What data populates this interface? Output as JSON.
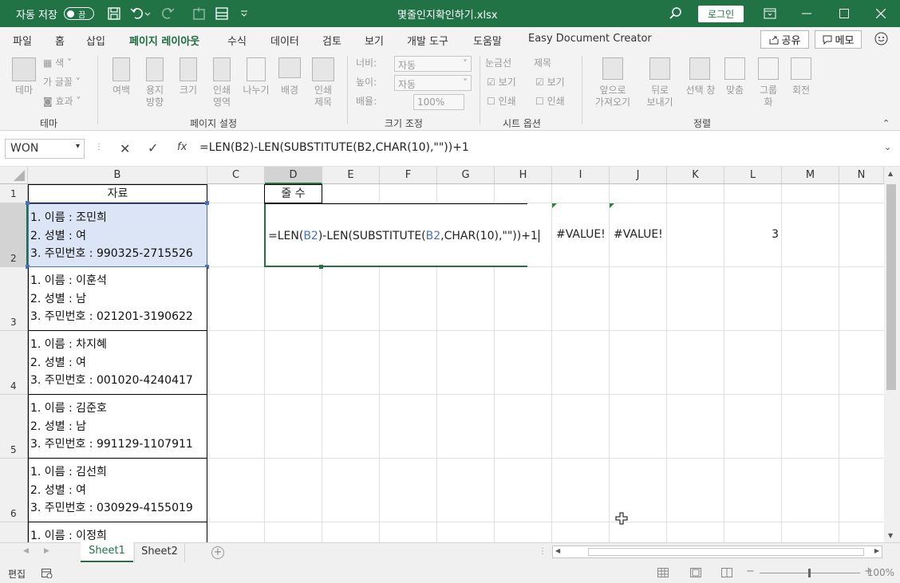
{
  "titlebar": {
    "autosave_label": "자동 저장",
    "autosave_state": "끔",
    "filename": "몇줄인지확인하기.xlsx",
    "login": "로그인"
  },
  "ribbon_tabs": [
    "파일",
    "홈",
    "삽입",
    "페이지 레이아웃",
    "수식",
    "데이터",
    "검토",
    "보기",
    "개발 도구",
    "도움말",
    "Easy Document Creator"
  ],
  "active_tab": "페이지 레이아웃",
  "share": "공유",
  "memo": "메모",
  "groups": {
    "theme": {
      "label": "테마",
      "theme_btn": "테마",
      "colors": "색",
      "fonts": "글꼴",
      "effects": "효과"
    },
    "page_setup": {
      "label": "페이지 설정",
      "margins": "여백",
      "orientation": "용지\n방향",
      "size": "크기",
      "print_area": "인쇄\n영역",
      "breaks": "나누기",
      "background": "배경",
      "print_titles": "인쇄\n제목"
    },
    "scale": {
      "label": "크기 조정",
      "width_label": "너비:",
      "width_val": "자동",
      "height_label": "높이:",
      "height_val": "자동",
      "scale_label": "배율:",
      "scale_val": "100%"
    },
    "sheet_options": {
      "label": "시트 옵션",
      "gridlines": "눈금선",
      "headings": "제목",
      "view": "보기",
      "print": "인쇄"
    },
    "arrange": {
      "label": "정렬",
      "forward": "앞으로\n가져오기",
      "backward": "뒤로\n보내기",
      "selection_pane": "선택 창",
      "align": "맞춤",
      "group": "그룹\n화",
      "rotate": "회전"
    }
  },
  "formula_bar": {
    "name_box": "WON",
    "fx": "fx",
    "formula": "=LEN(B2)-LEN(SUBSTITUTE(B2,CHAR(10),\"\"))+1"
  },
  "columns": [
    "B",
    "C",
    "D",
    "E",
    "F",
    "G",
    "H",
    "I",
    "J",
    "K",
    "L",
    "M",
    "N"
  ],
  "rows": [
    "1",
    "2",
    "3",
    "4",
    "5",
    "6"
  ],
  "header_b1": "자료",
  "header_d1": "줄 수",
  "records": [
    {
      "name": "1. 이름 : 조민희",
      "gender": "2. 성별 : 여",
      "id": "3. 주민번호 : 990325-2715526"
    },
    {
      "name": "1. 이름 : 이훈석",
      "gender": "2. 성별 : 남",
      "id": "3. 주민번호 : 021201-3190622"
    },
    {
      "name": "1. 이름 : 차지혜",
      "gender": "2. 성별 : 여",
      "id": "3. 주민번호 : 001020-4240417"
    },
    {
      "name": "1. 이름 : 김준호",
      "gender": "2. 성별 : 남",
      "id": "3. 주민번호 : 991129-1107911"
    },
    {
      "name": "1. 이름 : 김선희",
      "gender": "2. 성별 : 여",
      "id": "3. 주민번호 : 030929-4155019"
    },
    {
      "name": "1. 이름 : 이정희"
    }
  ],
  "edit_formula_parts": [
    "=LEN(",
    "B2",
    ")-LEN(SUBSTITUTE(",
    "B2",
    ",CHAR(10),\"\"))+1"
  ],
  "cell_i2": "#VALUE!",
  "cell_j2": "#VALUE!",
  "cell_l2": "3",
  "sheets": [
    "Sheet1",
    "Sheet2"
  ],
  "active_sheet": "Sheet1",
  "status_mode": "편집",
  "zoom": "100%",
  "colors": {
    "excel_green": "#217346",
    "selection_fill": "#dbe5f5",
    "ref_blue": "#4472c4"
  }
}
